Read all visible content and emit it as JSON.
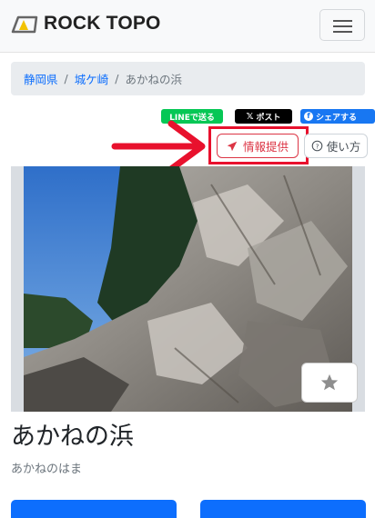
{
  "header": {
    "brand": "ROCK TOPO",
    "menu_icon": "hamburger-icon"
  },
  "breadcrumb": {
    "items": [
      "静岡県",
      "城ケ崎"
    ],
    "current": "あかねの浜"
  },
  "share": {
    "line": "LINEで送る",
    "x": "ポスト",
    "facebook": "シェアする"
  },
  "actions": {
    "report": "情報提供",
    "help": "使い方"
  },
  "photo": {
    "favorite_icon": "star-icon"
  },
  "spot": {
    "name": "あかねの浜",
    "reading": "あかねのはま"
  },
  "colors": {
    "link": "#0d6efd",
    "danger": "#dc3545",
    "annotation": "#e8112d",
    "primary": "#0d6efd"
  }
}
